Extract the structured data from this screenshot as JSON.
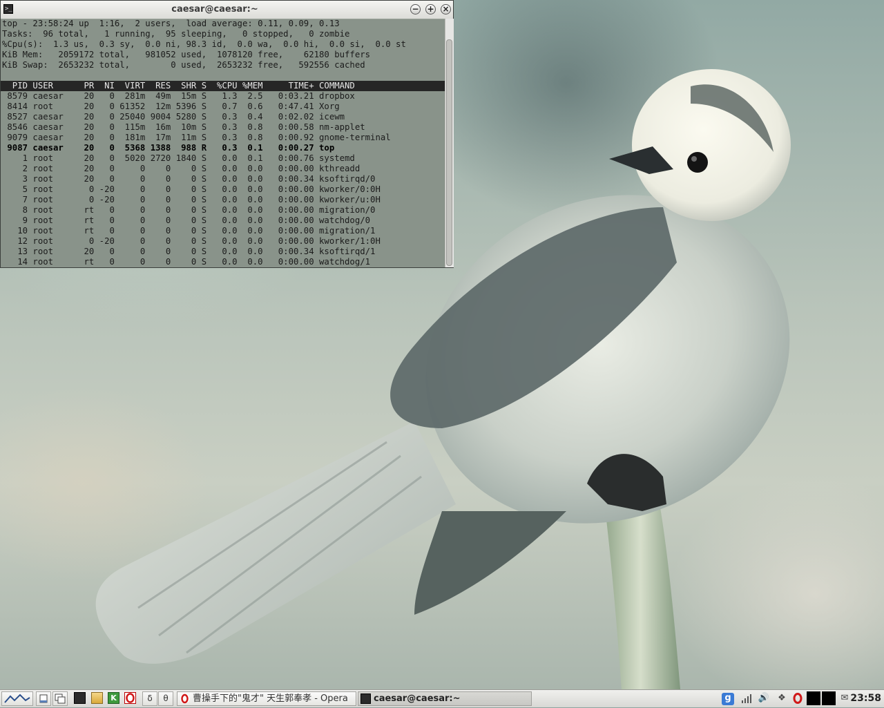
{
  "window": {
    "title": "caesar@caesar:~"
  },
  "top": {
    "summary": [
      "top - 23:58:24 up  1:16,  2 users,  load average: 0.11, 0.09, 0.13",
      "Tasks:  96 total,   1 running,  95 sleeping,   0 stopped,   0 zombie",
      "%Cpu(s):  1.3 us,  0.3 sy,  0.0 ni, 98.3 id,  0.0 wa,  0.0 hi,  0.0 si,  0.0 st",
      "KiB Mem:   2059172 total,   981052 used,  1078120 free,    62180 buffers",
      "KiB Swap:  2653232 total,        0 used,  2653232 free,   592556 cached"
    ],
    "header": "  PID USER      PR  NI  VIRT  RES  SHR S  %CPU %MEM     TIME+ COMMAND",
    "processes": [
      " 8579 caesar    20   0  281m  49m  15m S   1.3  2.5   0:03.21 dropbox",
      " 8414 root      20   0 61352  12m 5396 S   0.7  0.6   0:47.41 Xorg",
      " 8527 caesar    20   0 25040 9004 5280 S   0.3  0.4   0:02.02 icewm",
      " 8546 caesar    20   0  115m  16m  10m S   0.3  0.8   0:00.58 nm-applet",
      " 9079 caesar    20   0  181m  17m  11m S   0.3  0.8   0:00.92 gnome-terminal",
      " 9087 caesar    20   0  5368 1388  988 R   0.3  0.1   0:00.27 top",
      "    1 root      20   0  5020 2720 1840 S   0.0  0.1   0:00.76 systemd",
      "    2 root      20   0     0    0    0 S   0.0  0.0   0:00.00 kthreadd",
      "    3 root      20   0     0    0    0 S   0.0  0.0   0:00.34 ksoftirqd/0",
      "    5 root       0 -20     0    0    0 S   0.0  0.0   0:00.00 kworker/0:0H",
      "    7 root       0 -20     0    0    0 S   0.0  0.0   0:00.00 kworker/u:0H",
      "    8 root      rt   0     0    0    0 S   0.0  0.0   0:00.00 migration/0",
      "    9 root      rt   0     0    0    0 S   0.0  0.0   0:00.00 watchdog/0",
      "   10 root      rt   0     0    0    0 S   0.0  0.0   0:00.00 migration/1",
      "   12 root       0 -20     0    0    0 S   0.0  0.0   0:00.00 kworker/1:0H",
      "   13 root      20   0     0    0    0 S   0.0  0.0   0:00.34 ksoftirqd/1",
      "   14 root      rt   0     0    0    0 S   0.0  0.0   0:00.00 watchdog/1"
    ]
  },
  "taskbar": {
    "workspaces": [
      "δ",
      "θ"
    ],
    "tasks": [
      {
        "label": "曹操手下的\"鬼才\" 天生郭奉孝 - Opera",
        "icon": "opera-icon"
      },
      {
        "label": "caesar@caesar:~",
        "icon": "terminal-icon"
      }
    ],
    "clock": "23:58",
    "tray_icons": [
      "gnome-g-icon",
      "network-signal-icon",
      "volume-icon",
      "dropbox-icon",
      "opera-icon",
      "cpu-graph-icon",
      "mem-graph-icon",
      "mail-icon"
    ]
  }
}
